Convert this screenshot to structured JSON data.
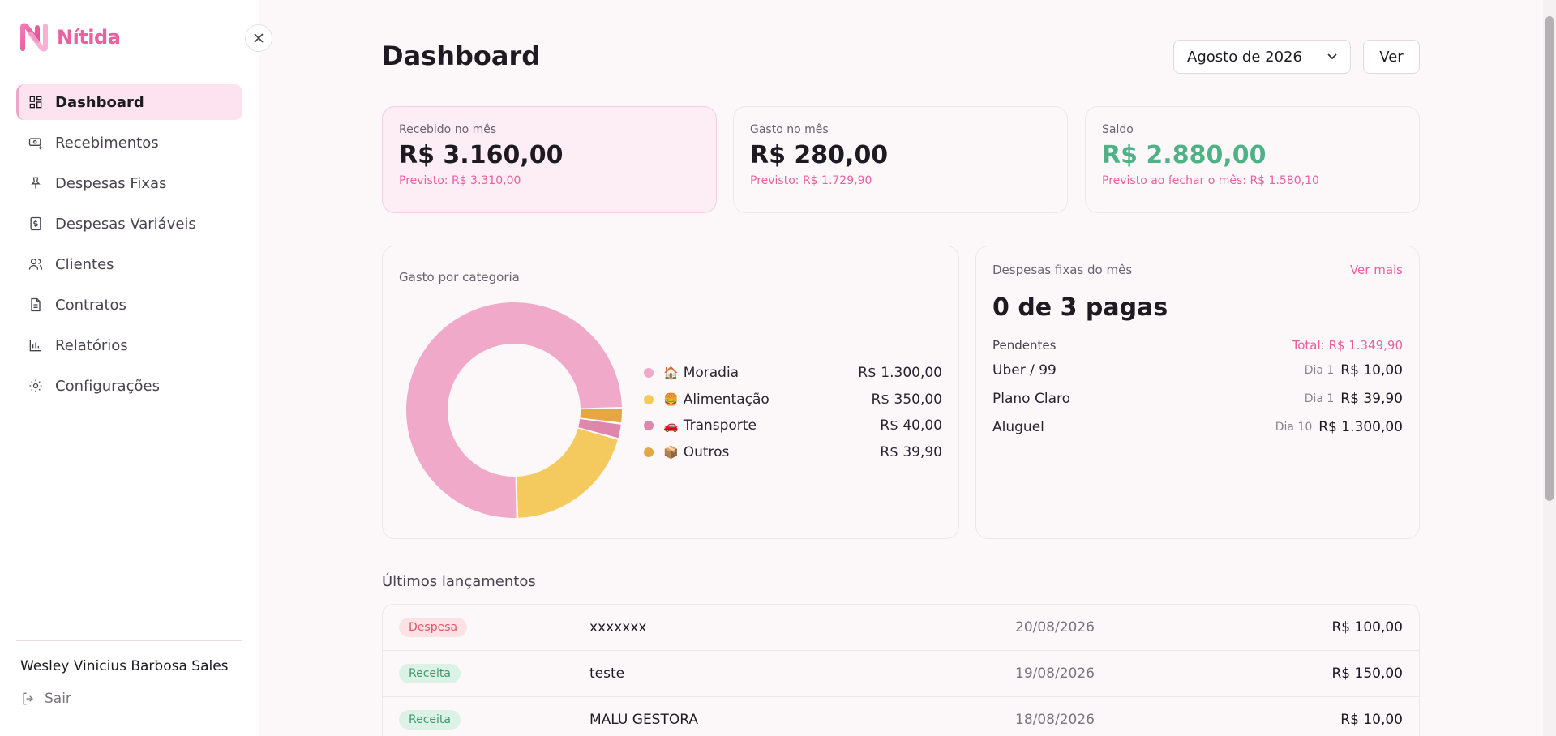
{
  "brand": {
    "name": "Nítida"
  },
  "sidebar": {
    "items": [
      {
        "label": "Dashboard",
        "icon": "dashboard-icon",
        "active": true
      },
      {
        "label": "Recebimentos",
        "icon": "money-receive-icon"
      },
      {
        "label": "Despesas Fixas",
        "icon": "pin-icon"
      },
      {
        "label": "Despesas Variáveis",
        "icon": "dollar-receipt-icon"
      },
      {
        "label": "Clientes",
        "icon": "users-icon"
      },
      {
        "label": "Contratos",
        "icon": "document-icon"
      },
      {
        "label": "Relatórios",
        "icon": "bar-chart-icon"
      },
      {
        "label": "Configurações",
        "icon": "gear-icon"
      }
    ],
    "user_name": "Wesley Vinicius Barbosa Sales",
    "logout_label": "Sair"
  },
  "header": {
    "title": "Dashboard",
    "month_selected": "Agosto de 2026",
    "ver_label": "Ver"
  },
  "stats": [
    {
      "label": "Recebido no mês",
      "value": "R$ 3.160,00",
      "sub": "Previsto: R$ 3.310,00"
    },
    {
      "label": "Gasto no mês",
      "value": "R$ 280,00",
      "sub": "Previsto: R$ 1.729,90"
    },
    {
      "label": "Saldo",
      "value": "R$ 2.880,00",
      "sub": "Previsto ao fechar o mês: R$ 1.580,10"
    }
  ],
  "categories_card": {
    "title": "Gasto por categoria"
  },
  "chart_data": {
    "type": "pie",
    "categories": [
      "Moradia",
      "Alimentação",
      "Transporte",
      "Outros"
    ],
    "values": [
      1300.0,
      350.0,
      40.0,
      39.9
    ],
    "value_labels": [
      "R$ 1.300,00",
      "R$ 350,00",
      "R$ 40,00",
      "R$ 39,90"
    ],
    "emojis": [
      "🏠",
      "🍔",
      "🚗",
      "📦"
    ],
    "colors": [
      "#f0a9c8",
      "#f4c95e",
      "#de86ac",
      "#e3a744"
    ],
    "legend": "right"
  },
  "fixed": {
    "title": "Despesas fixas do mês",
    "more_label": "Ver mais",
    "summary": "0 de 3 pagas",
    "pending_label": "Pendentes",
    "total_label": "Total: R$ 1.349,90",
    "items": [
      {
        "name": "Uber / 99",
        "day": "Dia 1",
        "value": "R$ 10,00"
      },
      {
        "name": "Plano Claro",
        "day": "Dia 1",
        "value": "R$ 39,90"
      },
      {
        "name": "Aluguel",
        "day": "Dia 10",
        "value": "R$ 1.300,00"
      }
    ]
  },
  "recent": {
    "title": "Últimos lançamentos",
    "rows": [
      {
        "type": "Despesa",
        "kind": "despesa",
        "description": "xxxxxxx",
        "date": "20/08/2026",
        "value": "R$ 100,00"
      },
      {
        "type": "Receita",
        "kind": "receita",
        "description": "teste",
        "date": "19/08/2026",
        "value": "R$ 150,00"
      },
      {
        "type": "Receita",
        "kind": "receita",
        "description": "MALU GESTORA",
        "date": "18/08/2026",
        "value": "R$ 10,00"
      }
    ]
  }
}
